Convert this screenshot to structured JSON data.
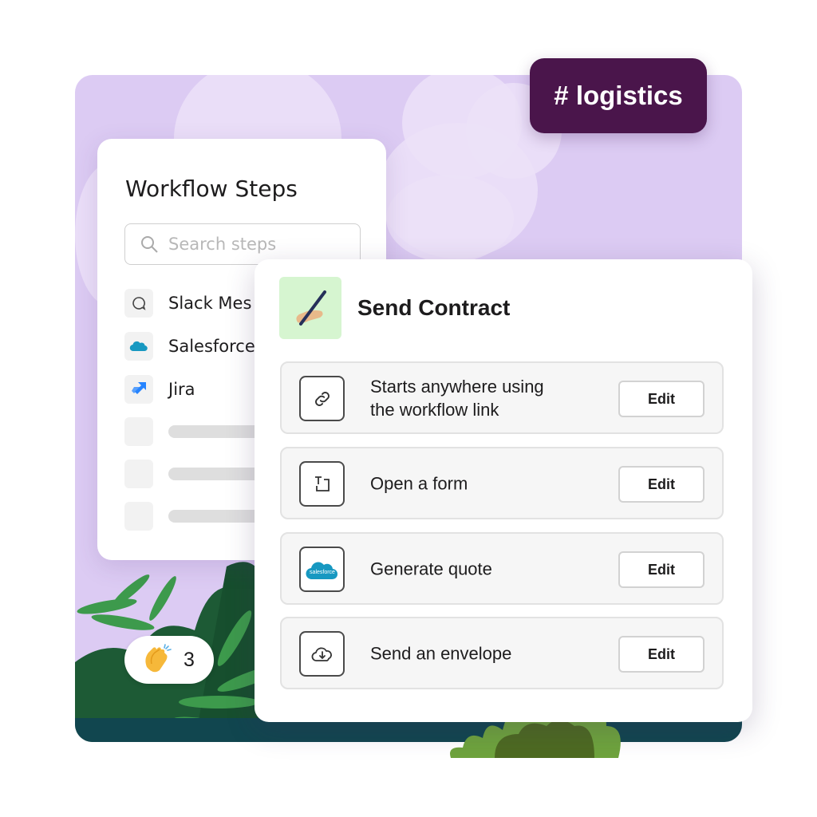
{
  "channel_tag": "# logistics",
  "workflow_panel": {
    "title": "Workflow Steps",
    "search": {
      "placeholder": "Search steps",
      "value": ""
    },
    "items": [
      {
        "label": "Slack Mes",
        "icon": "chat-bubble-icon"
      },
      {
        "label": "Salesforce",
        "icon": "salesforce-cloud-icon"
      },
      {
        "label": "Jira",
        "icon": "jira-icon"
      }
    ],
    "placeholder_rows": 3
  },
  "send_contract": {
    "title": "Send Contract",
    "emoji": "writing-hand-icon",
    "steps": [
      {
        "label_line1": "Starts anywhere using",
        "label_line2": "the workflow link",
        "icon": "link-icon",
        "button": "Edit"
      },
      {
        "label_line1": "Open a form",
        "label_line2": "",
        "icon": "form-icon",
        "button": "Edit"
      },
      {
        "label_line1": "Generate quote",
        "label_line2": "",
        "icon": "salesforce-logo-icon",
        "button": "Edit",
        "icon_text": "salesforce"
      },
      {
        "label_line1": "Send an envelope",
        "label_line2": "",
        "icon": "cloud-download-icon",
        "button": "Edit"
      }
    ]
  },
  "reaction": {
    "emoji": "clapping-hands-icon",
    "count": "3"
  },
  "colors": {
    "background_lilac": "#dccbf3",
    "tag_aubergine": "#4a154b",
    "emoji_bg": "#d6f5d0",
    "salesforce_blue": "#1798c1",
    "jira_blue": "#2684ff",
    "ground": "#11464f"
  }
}
